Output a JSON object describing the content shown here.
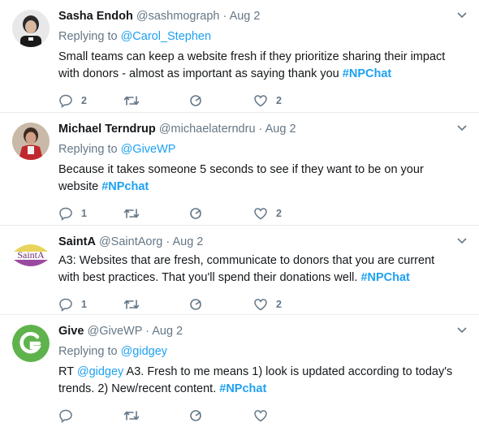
{
  "tweets": [
    {
      "name": "Sasha Endoh",
      "handle": "@sashmograph",
      "time": "Aug 2",
      "replying_label": "Replying to",
      "replying_to": "@Carol_Stephen",
      "text": "Small teams can keep a website fresh if they prioritize sharing their impact with donors - almost as important as saying thank you ",
      "hashtag": "#NPChat",
      "replies": "2",
      "likes": "2"
    },
    {
      "name": "Michael Terndrup",
      "handle": "@michaelaterndru",
      "time": "Aug 2",
      "replying_label": "Replying to",
      "replying_to": "@GiveWP",
      "text": "Because it takes someone 5 seconds to see if they want to be on your website ",
      "hashtag": "#NPchat",
      "replies": "1",
      "likes": "2"
    },
    {
      "name": "SaintA",
      "handle": "@SaintAorg",
      "time": "Aug 2",
      "avatar_text": "SaintA",
      "text": "A3: Websites that are fresh, communicate to donors that you are current with best practices. That you'll spend their donations well. ",
      "hashtag": "#NPChat",
      "replies": "1",
      "likes": "2"
    },
    {
      "name": "Give",
      "handle": "@GiveWP",
      "time": "Aug 2",
      "replying_label": "Replying to",
      "replying_to": "@gidgey",
      "text_prefix": "RT ",
      "mention": "@gidgey",
      "text": " A3. Fresh to me means 1) look is updated according to today's trends. 2) New/recent content. ",
      "hashtag": "#NPchat"
    }
  ],
  "separator": " · ",
  "colors": {
    "link": "#1da1f2",
    "muted": "#657786",
    "border": "#e6ecf0",
    "give_green": "#5fb34d"
  }
}
